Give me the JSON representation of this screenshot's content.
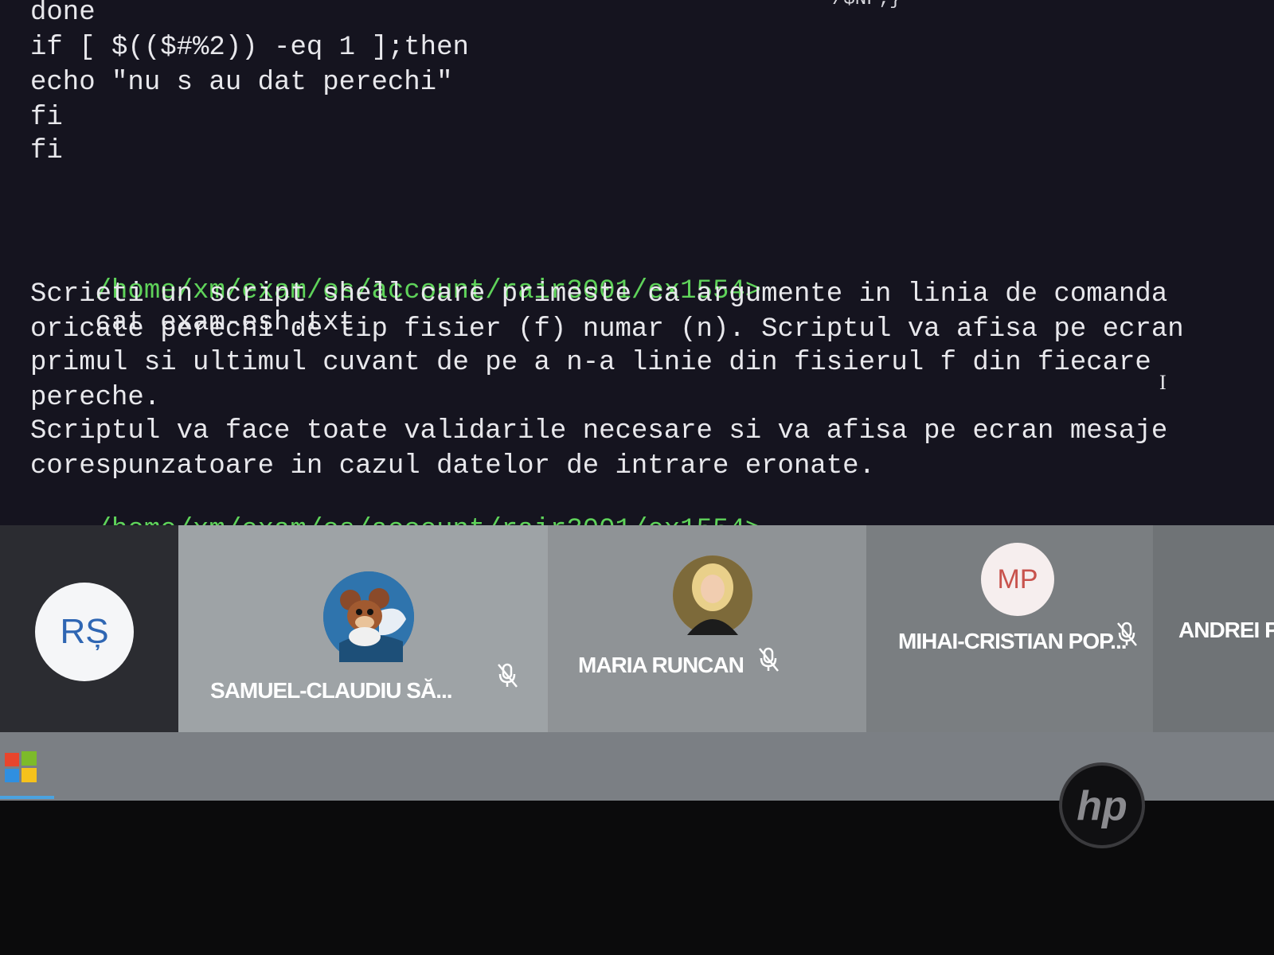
{
  "terminal": {
    "top_fragment": "/$NF;}'",
    "lines": [
      {
        "text": "done",
        "kind": "output"
      },
      {
        "text": "if [ $(($#%2)) -eq 1 ];then",
        "kind": "output"
      },
      {
        "text": "echo \"nu s au dat perechi\"",
        "kind": "output"
      },
      {
        "text": "fi",
        "kind": "output"
      },
      {
        "text": "fi",
        "kind": "output"
      }
    ],
    "prompt_path": "/home/xm/exam/os/account/rair3001/ex1554>",
    "command": "cat exam-esh.txt",
    "file_lines": [
      "Scrieti un script shell care primeste ca argumente in linia de comanda",
      "oricate perechi de tip fisier (f) numar (n). Scriptul va afisa pe ecran",
      "primul si ultimul cuvant de pe a n-a linie din fisierul f din fiecare",
      "pereche.",
      "Scriptul va face toate validarile necesare si va afisa pe ecran mesaje",
      "corespunzatoare in cazul datelor de intrare eronate."
    ],
    "cursor_glyph": "I",
    "colors": {
      "prompt": "#5fd35a",
      "text": "#e8e8ec",
      "cursor": "#33ee4a",
      "background": "#15141f"
    }
  },
  "participants": [
    {
      "initials": "RȘ",
      "name": "",
      "muted": false,
      "avatar": "initials"
    },
    {
      "initials": "",
      "name": "SAMUEL-CLAUDIU SĂ...",
      "muted": true,
      "avatar": "cartoon-mouse-image"
    },
    {
      "initials": "",
      "name": "MARIA RUNCAN",
      "muted": true,
      "avatar": "profile-photo"
    },
    {
      "initials": "MP",
      "name": "MIHAI-CRISTIAN POP...",
      "muted": true,
      "avatar": "initials"
    },
    {
      "initials": "",
      "name": "ANDREI P",
      "muted": false,
      "avatar": "none"
    }
  ],
  "taskbar": {
    "start_icon": "windows-logo-icon"
  },
  "monitor": {
    "brand_logo": "hp-logo"
  }
}
